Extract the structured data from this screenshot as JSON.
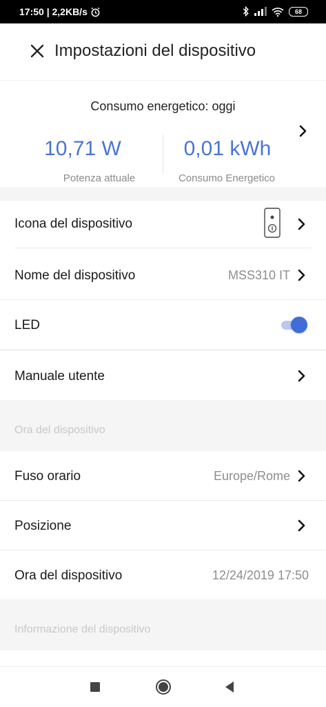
{
  "status_bar": {
    "time_speed": "17:50 | 2,2KB/s",
    "battery": "68"
  },
  "header": {
    "title": "Impostazioni del dispositivo"
  },
  "energy": {
    "title": "Consumo energetico: oggi",
    "power_value": "10,71 W",
    "power_label": "Potenza attuale",
    "consumption_value": "0,01 kWh",
    "consumption_label": "Consumo Energetico",
    "accent_color": "#4a74d4"
  },
  "rows": {
    "device_icon": {
      "label": "Icona del dispositivo"
    },
    "device_name": {
      "label": "Nome del dispositivo",
      "value": "MSS310 IT"
    },
    "led": {
      "label": "LED",
      "enabled": true
    },
    "manual": {
      "label": "Manuale utente"
    }
  },
  "section_time": {
    "label": "Ora del dispositivo",
    "timezone": {
      "label": "Fuso orario",
      "value": "Europe/Rome"
    },
    "position": {
      "label": "Posizione"
    },
    "device_time": {
      "label": "Ora del dispositivo",
      "value": "12/24/2019 17:50"
    }
  },
  "section_info": {
    "label": "Informazione del dispositivo"
  },
  "icons": {
    "close": "close-icon",
    "chevron": "chevron-right-icon",
    "plug": "smart-plug-icon"
  }
}
